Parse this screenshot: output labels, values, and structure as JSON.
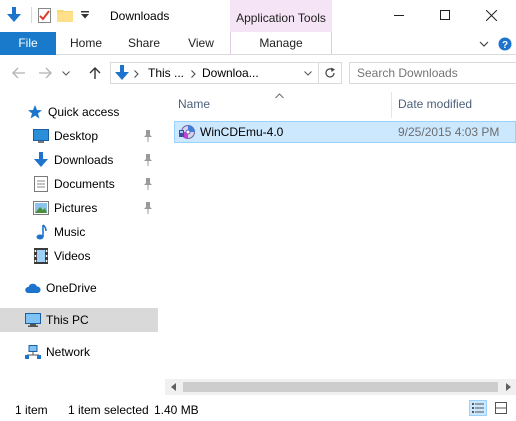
{
  "window": {
    "title": "Downloads",
    "contextual_tab_group": "Application Tools"
  },
  "ribbon": {
    "tabs": [
      {
        "label": "File"
      },
      {
        "label": "Home"
      },
      {
        "label": "Share"
      },
      {
        "label": "View"
      },
      {
        "label": "Manage"
      }
    ]
  },
  "address": {
    "crumbs": [
      "This ...",
      "Downloa..."
    ],
    "search_placeholder": "Search Downloads"
  },
  "nav": {
    "quick_access": "Quick access",
    "items": [
      {
        "label": "Desktop",
        "pinned": true
      },
      {
        "label": "Downloads",
        "pinned": true
      },
      {
        "label": "Documents",
        "pinned": true
      },
      {
        "label": "Pictures",
        "pinned": true
      },
      {
        "label": "Music",
        "pinned": false
      },
      {
        "label": "Videos",
        "pinned": false
      }
    ],
    "onedrive": "OneDrive",
    "this_pc": "This PC",
    "network": "Network"
  },
  "columns": {
    "name": "Name",
    "date_modified": "Date modified"
  },
  "files": [
    {
      "name": "WinCDEmu-4.0",
      "date": "9/25/2015 4:03 PM"
    }
  ],
  "status": {
    "count": "1 item",
    "selection": "1 item selected",
    "size": "1.40 MB"
  },
  "colors": {
    "accent": "#1979ca",
    "selection": "#cce8ff",
    "contextual": "#f4e4f6"
  },
  "icons": {
    "qat": [
      "down-arrow-icon",
      "properties-icon",
      "new-folder-icon",
      "customize-icon"
    ],
    "nav": [
      "star-icon",
      "desktop-icon",
      "download-icon",
      "documents-icon",
      "pictures-icon",
      "music-icon",
      "videos-icon",
      "cloud-icon",
      "computer-icon",
      "network-icon"
    ]
  }
}
